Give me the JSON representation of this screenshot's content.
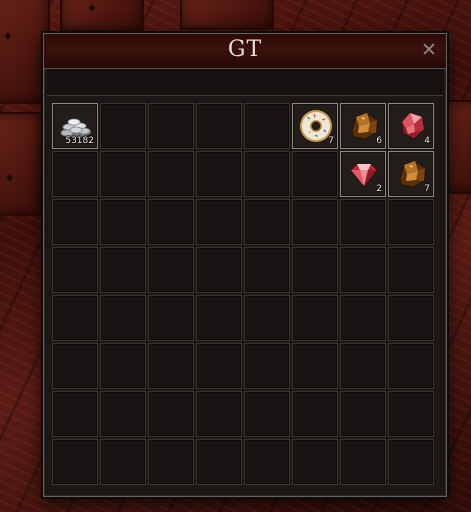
{
  "window": {
    "title": "GT",
    "close_label": "✕"
  },
  "inventory": {
    "columns": 8,
    "rows": 8,
    "items": [
      {
        "row": 0,
        "col": 0,
        "icon": "silver-coins-icon",
        "quantity": "53182"
      },
      {
        "row": 0,
        "col": 5,
        "icon": "donut-icon",
        "quantity": "7"
      },
      {
        "row": 0,
        "col": 6,
        "icon": "amber-ore-icon",
        "quantity": "6"
      },
      {
        "row": 0,
        "col": 7,
        "icon": "ruby-crystal-icon",
        "quantity": "4"
      },
      {
        "row": 1,
        "col": 6,
        "icon": "ruby-gem-icon",
        "quantity": "2"
      },
      {
        "row": 1,
        "col": 7,
        "icon": "amber-ore-icon",
        "quantity": "7"
      }
    ]
  }
}
